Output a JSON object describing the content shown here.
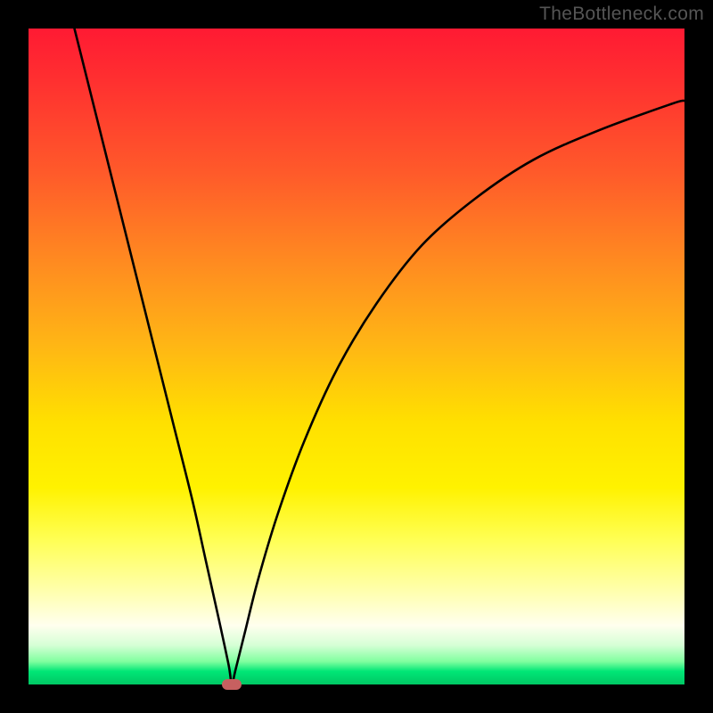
{
  "attribution": "TheBottleneck.com",
  "chart_data": {
    "type": "line",
    "title": "",
    "xlabel": "",
    "ylabel": "",
    "xlim": [
      0,
      100
    ],
    "ylim": [
      0,
      100
    ],
    "grid": false,
    "legend": false,
    "marker": {
      "x": 31,
      "y": 0
    },
    "series": [
      {
        "name": "bottleneck-curve",
        "x": [
          7.0,
          10,
          13,
          16,
          19,
          22,
          25,
          27,
          29,
          30.5,
          31,
          31.5,
          33,
          35,
          38,
          42,
          47,
          53,
          60,
          68,
          77,
          87,
          98,
          100
        ],
        "y": [
          100,
          88,
          76,
          64,
          52,
          40,
          28,
          19,
          10,
          3,
          0,
          2,
          8,
          16,
          26,
          37,
          48,
          58,
          67,
          74,
          80,
          84.5,
          88.5,
          89
        ]
      }
    ],
    "annotations": [],
    "background": "heat-gradient-red-to-green"
  }
}
